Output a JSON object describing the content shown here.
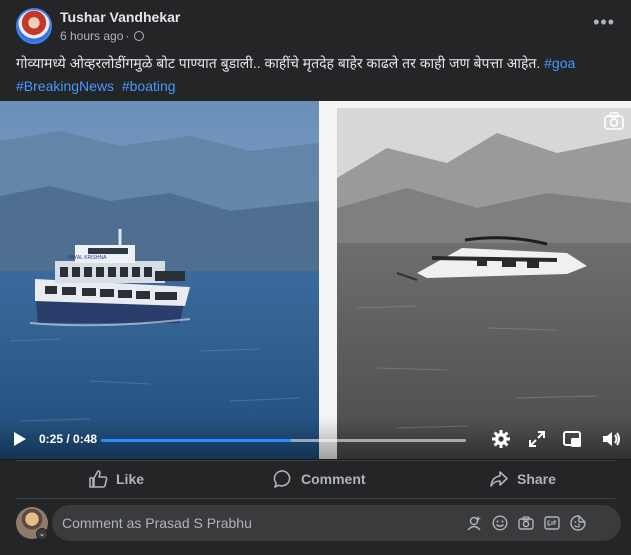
{
  "post": {
    "author": "Tushar Vandhekar",
    "time": "6 hours ago",
    "separator": "·",
    "caption_text": "गोव्यामध्ये ओव्हरलोडींगमुळे बोट पाण्यात बुडाली.. काहींचे मृतदेह बाहेर काढले तर काही जण बेपत्ता आहेत.",
    "hashtags": [
      "#goa",
      "#BreakingNews",
      "#boating"
    ],
    "boat_banner": "PAYAL KRISHNA"
  },
  "video": {
    "current_time": "0:25",
    "duration": "0:48",
    "time_display": "0:25 / 0:48",
    "progress_fraction": 0.52
  },
  "actions": {
    "like": "Like",
    "comment": "Comment",
    "share": "Share"
  },
  "comment_box": {
    "placeholder": "Comment as Prasad S Prabhu"
  },
  "colors": {
    "background": "#242526",
    "hashtag": "#4599ff",
    "progress": "#2d88ff",
    "muted_text": "#b0b3b8"
  },
  "icons": [
    "globe-icon",
    "more-options-icon",
    "camera-icon",
    "play-icon",
    "settings-icon",
    "expand-icon",
    "pip-icon",
    "volume-icon",
    "like-icon",
    "comment-icon",
    "share-icon",
    "avatar-sticker-icon",
    "emoji-icon",
    "camera-icon",
    "gif-icon",
    "sticker-icon"
  ]
}
